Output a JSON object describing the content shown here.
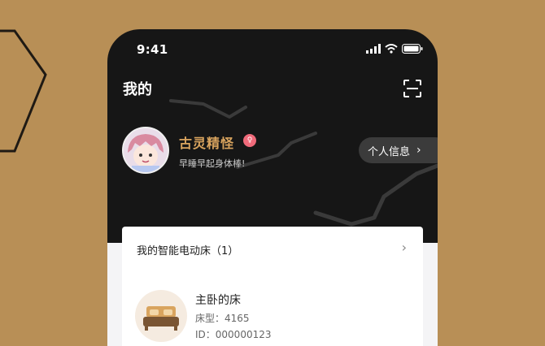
{
  "status_bar": {
    "time": "9:41"
  },
  "header": {
    "title": "我的",
    "scan_icon": "scan-icon"
  },
  "profile": {
    "nickname": "古灵精怪",
    "badge_icon": "female-icon",
    "signature": "早睡早起身体棒!",
    "info_button_label": "个人信息",
    "info_button_chevron": "›"
  },
  "devices_card": {
    "title": "我的智能电动床（1）",
    "chevron": "›",
    "device": {
      "icon": "bed-icon",
      "name": "主卧的床",
      "type_label": "床型：4165",
      "id_label": "ID：000000123"
    }
  },
  "colors": {
    "backdrop": "#b88f56",
    "phone_bg": "#161616",
    "accent_gold": "#d9a45e",
    "badge_pink": "#f06a7a",
    "card_bg": "#ffffff"
  }
}
